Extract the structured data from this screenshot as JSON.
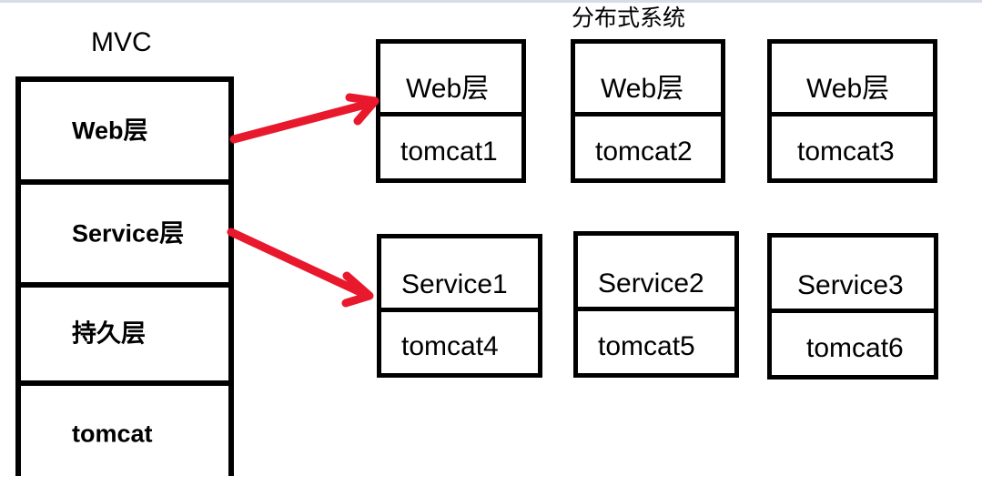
{
  "diagram": {
    "left_label": "MVC",
    "right_label": "分布式系统",
    "accent_color": "#E8192C",
    "line_color": "#000000",
    "background": "#FFFFFF"
  },
  "mvc_stack": {
    "name": "MVC",
    "layers": [
      {
        "label": "Web层"
      },
      {
        "label": "Service层"
      },
      {
        "label": "持久层"
      },
      {
        "label": "tomcat"
      }
    ]
  },
  "distributed": {
    "title": "分布式系统",
    "web_row": [
      {
        "top": "Web层",
        "bottom": "tomcat1"
      },
      {
        "top": "Web层",
        "bottom": "tomcat2"
      },
      {
        "top": "Web层",
        "bottom": "tomcat3"
      }
    ],
    "service_row": [
      {
        "top": "Service1",
        "bottom": "tomcat4"
      },
      {
        "top": "Service2",
        "bottom": "tomcat5"
      },
      {
        "top": "Service3",
        "bottom": "tomcat6"
      }
    ]
  },
  "arrows": [
    {
      "name": "web-layer-arrow",
      "from": "Web层",
      "to": "Web层 / tomcat1"
    },
    {
      "name": "service-layer-arrow",
      "from": "Service层",
      "to": "Service1 / tomcat4"
    }
  ]
}
